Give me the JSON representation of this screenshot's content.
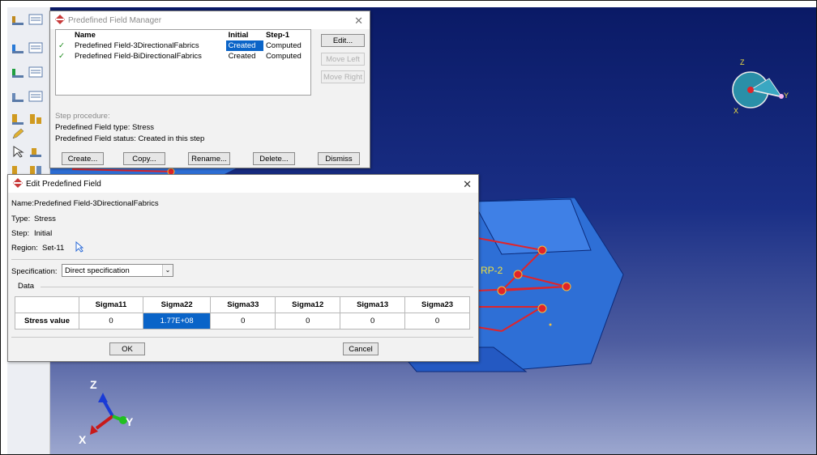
{
  "manager": {
    "title": "Predefined Field Manager",
    "columns": [
      "Name",
      "Initial",
      "Step-1"
    ],
    "rows": [
      {
        "name": "Predefined Field-3DirectionalFabrics",
        "initial": "Created",
        "step1": "Computed"
      },
      {
        "name": "Predefined Field-BiDirectionalFabrics",
        "initial": "Created",
        "step1": "Computed"
      }
    ],
    "side_buttons": {
      "edit": "Edit...",
      "move_left": "Move Left",
      "move_right": "Move Right"
    },
    "step_procedure": "Step procedure:",
    "field_type": "Predefined Field type:   Stress",
    "field_status": "Predefined Field status: Created in this step",
    "bottom_buttons": {
      "create": "Create...",
      "copy": "Copy...",
      "rename": "Rename...",
      "delete": "Delete...",
      "dismiss": "Dismiss"
    }
  },
  "editor": {
    "title": "Edit Predefined Field",
    "name_label": "Name:",
    "name_value": "Predefined Field-3DirectionalFabrics",
    "type_label": "Type:",
    "type_value": "Stress",
    "step_label": "Step:",
    "step_value": "Initial",
    "region_label": "Region:",
    "region_value": "Set-11",
    "spec_label": "Specification:",
    "spec_value": "Direct specification",
    "data_group": "Data",
    "table_headers": [
      "",
      "Sigma11",
      "Sigma22",
      "Sigma33",
      "Sigma12",
      "Sigma13",
      "Sigma23"
    ],
    "row_label": "Stress value",
    "row_values": [
      "0",
      "1.77E+08",
      "0",
      "0",
      "0",
      "0"
    ],
    "ok": "OK",
    "cancel": "Cancel"
  },
  "viewport": {
    "rp_label": "RP-2",
    "triad_small": {
      "z": "Z",
      "y": "Y",
      "x": "X"
    },
    "triad_main": {
      "z": "Z",
      "y": "Y",
      "x": "X"
    }
  },
  "colors": {
    "selection": "#0a64c8",
    "part": "#2e6fd6",
    "edge": "#e0242a"
  }
}
